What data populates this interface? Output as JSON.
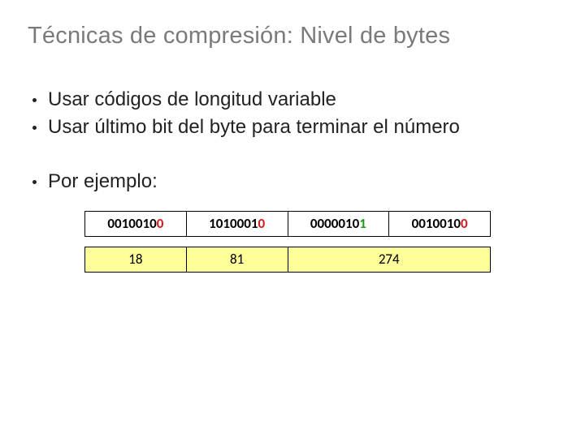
{
  "title": "Técnicas de compresión: Nivel de bytes",
  "bullets": {
    "b1": "Usar códigos de longitud variable",
    "b2": "Usar último bit del byte para terminar el número",
    "b3": "Por ejemplo:"
  },
  "bytes": {
    "c0": {
      "prefix": "0010010",
      "last": "0",
      "lastClass": "last0"
    },
    "c1": {
      "prefix": "1010001",
      "last": "0",
      "lastClass": "last0"
    },
    "c2": {
      "prefix": "0000010",
      "last": "1",
      "lastClass": "last1"
    },
    "c3": {
      "prefix": "0010010",
      "last": "0",
      "lastClass": "last0"
    }
  },
  "numbers": {
    "n0": "18",
    "n1": "81",
    "n2": "274"
  }
}
